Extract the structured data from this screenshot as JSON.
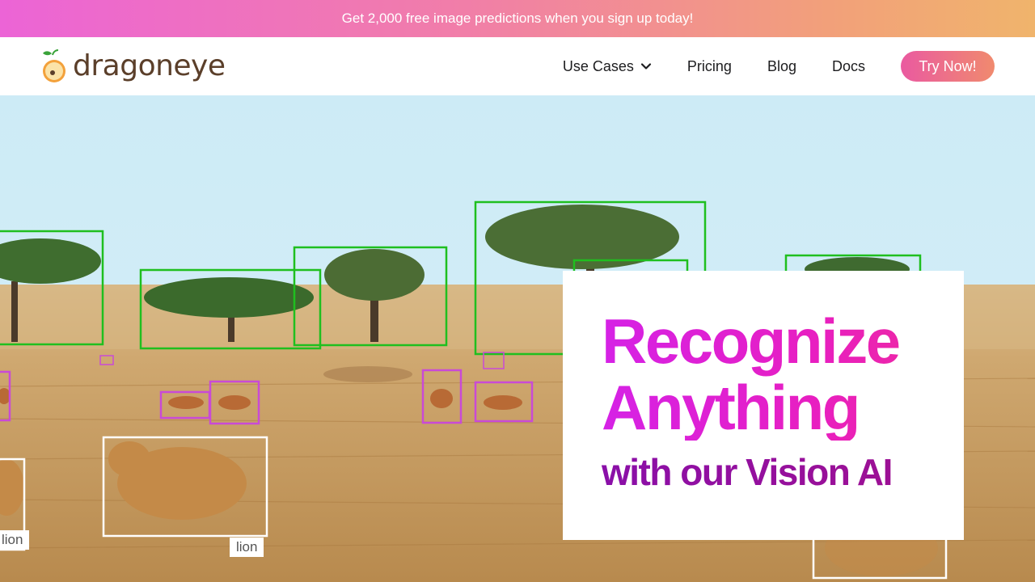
{
  "promo": {
    "text": "Get 2,000 free image predictions when you sign up today!"
  },
  "brand": {
    "name": "dragoneye",
    "logo_icon": "dragonfruit-icon"
  },
  "nav": {
    "items": [
      {
        "label": "Use Cases",
        "icon": "chevron-down-icon"
      },
      {
        "label": "Pricing"
      },
      {
        "label": "Blog"
      },
      {
        "label": "Docs"
      }
    ],
    "cta": "Try Now!"
  },
  "hero": {
    "headline_line1": "Recognize",
    "headline_line2": "Anything",
    "subheadline": "with our Vision AI",
    "detection_labels": [
      "lion",
      "lion"
    ]
  },
  "colors": {
    "tree_box": "#1fbf1f",
    "animal_box": "#c94ad6",
    "lion_box": "#ffffff",
    "headline_gradient": [
      "#d522e6",
      "#ef2b9a"
    ],
    "subheadline": "#8a0fa8",
    "cta_gradient": [
      "#ea5aa0",
      "#f08a6e"
    ]
  }
}
